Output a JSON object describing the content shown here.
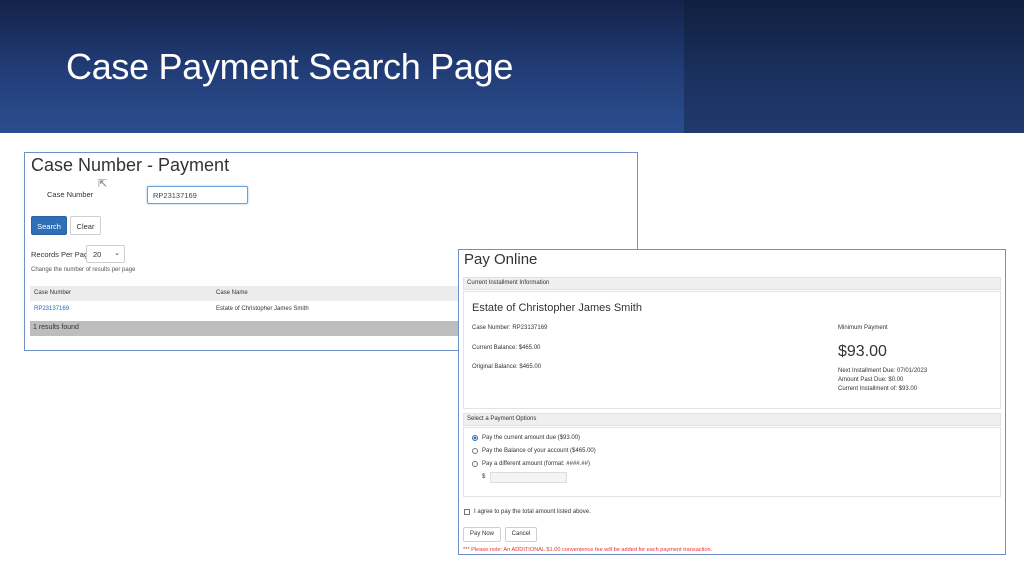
{
  "slide": {
    "title": "Case Payment Search Page"
  },
  "search": {
    "title": "Case Number - Payment",
    "case_number_label": "Case Number",
    "case_number_value": "RP23137169",
    "search_button": "Search",
    "clear_button": "Clear",
    "records_per_page_label": "Records Per Page",
    "records_per_page_value": "20",
    "records_hint": "Change the number of results per page",
    "columns": [
      "Case Number",
      "Case Name"
    ],
    "rows": [
      {
        "case_number": "RP23137169",
        "case_name": "Estate of Christopher James Smith"
      }
    ],
    "results_text": "1 results found"
  },
  "pay": {
    "title": "Pay Online",
    "installment_header": "Current Installment Information",
    "estate_name": "Estate of Christopher James Smith",
    "case_number": "Case Number: RP23137169",
    "current_balance": "Current Balance: $465.00",
    "original_balance": "Original Balance: $465.00",
    "min_payment_label": "Minimum Payment",
    "min_payment_amount": "$93.00",
    "next_due": "Next Installment Due: 07/01/2023",
    "past_due": "Amount Past Due: $0.00",
    "current_installment": "Current Installment of: $93.00",
    "options_header": "Select a Payment Options",
    "options": [
      "Pay the current amount due ($93.00)",
      "Pay the Balance of your account ($465.00)",
      "Pay a different amount (format: ####.##)"
    ],
    "dollar_sign": "$",
    "agree_text": "I agree to pay the total amount listed above.",
    "pay_now_button": "Pay Now",
    "cancel_button": "Cancel",
    "note": "*** Please note: An ADDITIONAL $1.00 convenience fee will be added for each payment transaction."
  }
}
